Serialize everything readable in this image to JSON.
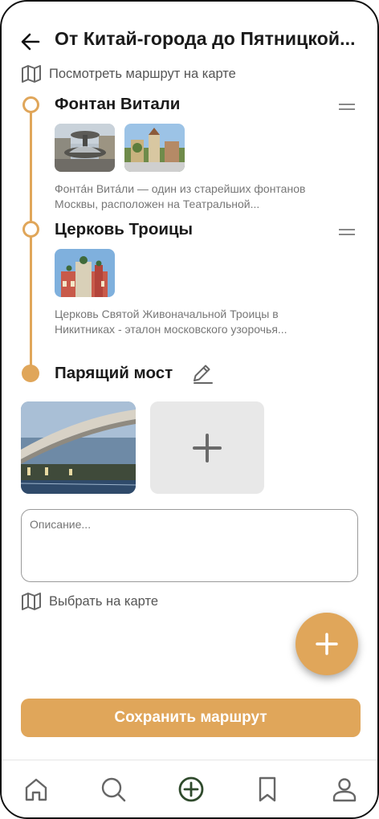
{
  "header": {
    "title": "От Китай-города до Пятницкой...",
    "map_link": "Посмотреть маршрут на карте"
  },
  "stops": [
    {
      "name": "Фонтан Витали",
      "description_line1": "Фонта́н Вита́ли — один из старейших фонтанов",
      "description_line2": "Москвы,  расположен на Театральной..."
    },
    {
      "name": "Церковь Троицы",
      "description_line1": "Церковь Святой Живоначальной Троицы в",
      "description_line2": "Никитниках - эталон московского узорочья..."
    }
  ],
  "current_stop": {
    "name": "Парящий мост",
    "description_placeholder": "Описание...",
    "choose_map_label": "Выбрать на карте"
  },
  "actions": {
    "save_label": "Сохранить маршрут"
  },
  "icons": {
    "back": "arrow-left-icon",
    "map": "map-icon",
    "drag": "drag-handle-icon",
    "edit": "pencil-icon",
    "add": "plus-icon",
    "nav": [
      "home-icon",
      "search-icon",
      "add-circle-icon",
      "bookmark-icon",
      "profile-icon"
    ]
  },
  "colors": {
    "accent": "#e0a65a",
    "active_nav": "#2f4a2c"
  }
}
